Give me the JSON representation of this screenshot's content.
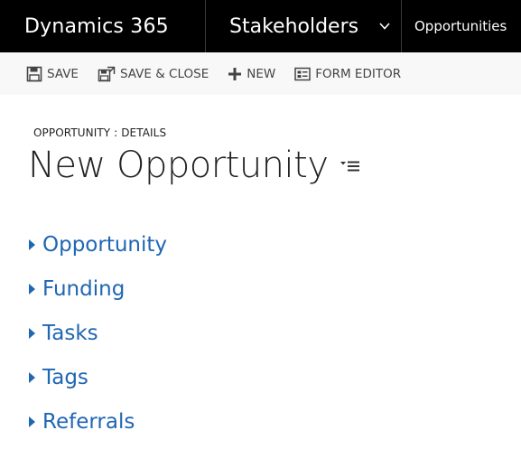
{
  "nav": {
    "brand": "Dynamics 365",
    "area": "Stakeholders",
    "entity": "Opportunities"
  },
  "toolbar": {
    "save_label": "SAVE",
    "save_close_label": "SAVE & CLOSE",
    "new_label": "NEW",
    "form_editor_label": "FORM EDITOR"
  },
  "form": {
    "breadcrumb": "OPPORTUNITY : DETAILS",
    "title": "New Opportunity"
  },
  "sections": [
    {
      "label": "Opportunity"
    },
    {
      "label": "Funding"
    },
    {
      "label": "Tasks"
    },
    {
      "label": "Tags"
    },
    {
      "label": "Referrals"
    }
  ],
  "colors": {
    "topbar": "#000000",
    "commandbar": "#f8f8f8",
    "section_link": "#1f66b3",
    "triangle": "#1f66b3"
  }
}
